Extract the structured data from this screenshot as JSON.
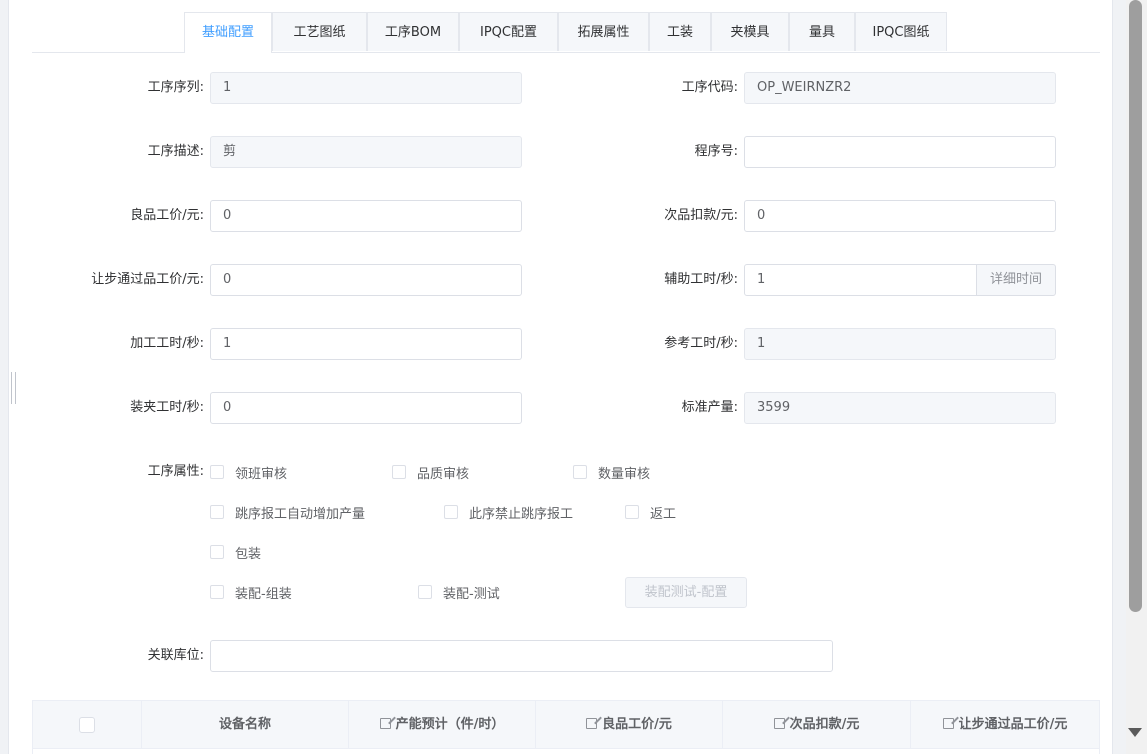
{
  "tabs": [
    "基础配置",
    "工艺图纸",
    "工序BOM",
    "IPQC配置",
    "拓展属性",
    "工装",
    "夹模具",
    "量具",
    "IPQC图纸"
  ],
  "active_tab": "基础配置",
  "form": {
    "seq_label": "工序序列:",
    "seq_value": "1",
    "code_label": "工序代码:",
    "code_value": "OP_WEIRNZR2",
    "desc_label": "工序描述:",
    "desc_value": "剪",
    "prog_label": "程序号:",
    "prog_value": "",
    "good_price_label": "良品工价/元:",
    "good_price_value": "0",
    "defect_deduct_label": "次品扣款/元:",
    "defect_deduct_value": "0",
    "pass_price_label": "让步通过品工价/元:",
    "pass_price_value": "0",
    "aux_time_label": "辅助工时/秒:",
    "aux_time_value": "1",
    "aux_time_btn": "详细时间",
    "proc_time_label": "加工工时/秒:",
    "proc_time_value": "1",
    "ref_time_label": "参考工时/秒:",
    "ref_time_value": "1",
    "clamp_time_label": "装夹工时/秒:",
    "clamp_time_value": "0",
    "std_output_label": "标准产量:",
    "std_output_value": "3599",
    "attr_label": "工序属性:",
    "attrs": [
      "领班审核",
      "品质审核",
      "数量审核",
      "跳序报工自动增加产量",
      "此序禁止跳序报工",
      "返工",
      "包装",
      "装配-组装",
      "装配-测试"
    ],
    "assembly_test_btn": "装配测试-配置",
    "location_label": "关联库位:",
    "location_value": ""
  },
  "table": {
    "headers": [
      "设备名称",
      "产能预计（件/时）",
      "良品工价/元",
      "次品扣款/元",
      "让步通过品工价/元"
    ]
  }
}
